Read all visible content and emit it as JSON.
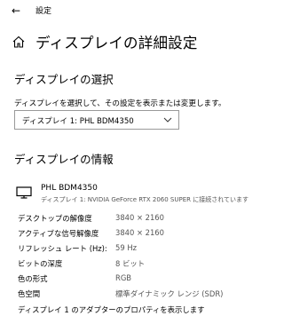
{
  "titlebar": {
    "back_label": "←",
    "app_title": "設定"
  },
  "page": {
    "title": "ディスプレイの詳細設定"
  },
  "select_section": {
    "heading": "ディスプレイの選択",
    "description": "ディスプレイを選択して、その設定を表示または変更します。",
    "selected_display": "ディスプレイ 1: PHL BDM4350"
  },
  "info_section": {
    "heading": "ディスプレイの情報",
    "monitor_name": "PHL BDM4350",
    "monitor_connection": "ディスプレイ 1: NVIDIA GeForce RTX 2060 SUPER に接続されています",
    "rows": [
      {
        "label": "デスクトップの解像度",
        "value": "3840 × 2160"
      },
      {
        "label": "アクティブな信号解像度",
        "value": "3840 × 2160"
      },
      {
        "label": "リフレッシュ レート (Hz):",
        "value": "59 Hz"
      },
      {
        "label": "ビットの深度",
        "value": "8 ビット"
      },
      {
        "label": "色の形式",
        "value": "RGB"
      },
      {
        "label": "色空間",
        "value": "標準ダイナミック レンジ (SDR)"
      }
    ],
    "adapter_link": "ディスプレイ 1 のアダプターのプロパティを表示します"
  },
  "icons": {
    "back": "back-arrow-icon",
    "home": "home-icon",
    "dropdown": "chevron-down-icon",
    "monitor": "monitor-icon"
  }
}
